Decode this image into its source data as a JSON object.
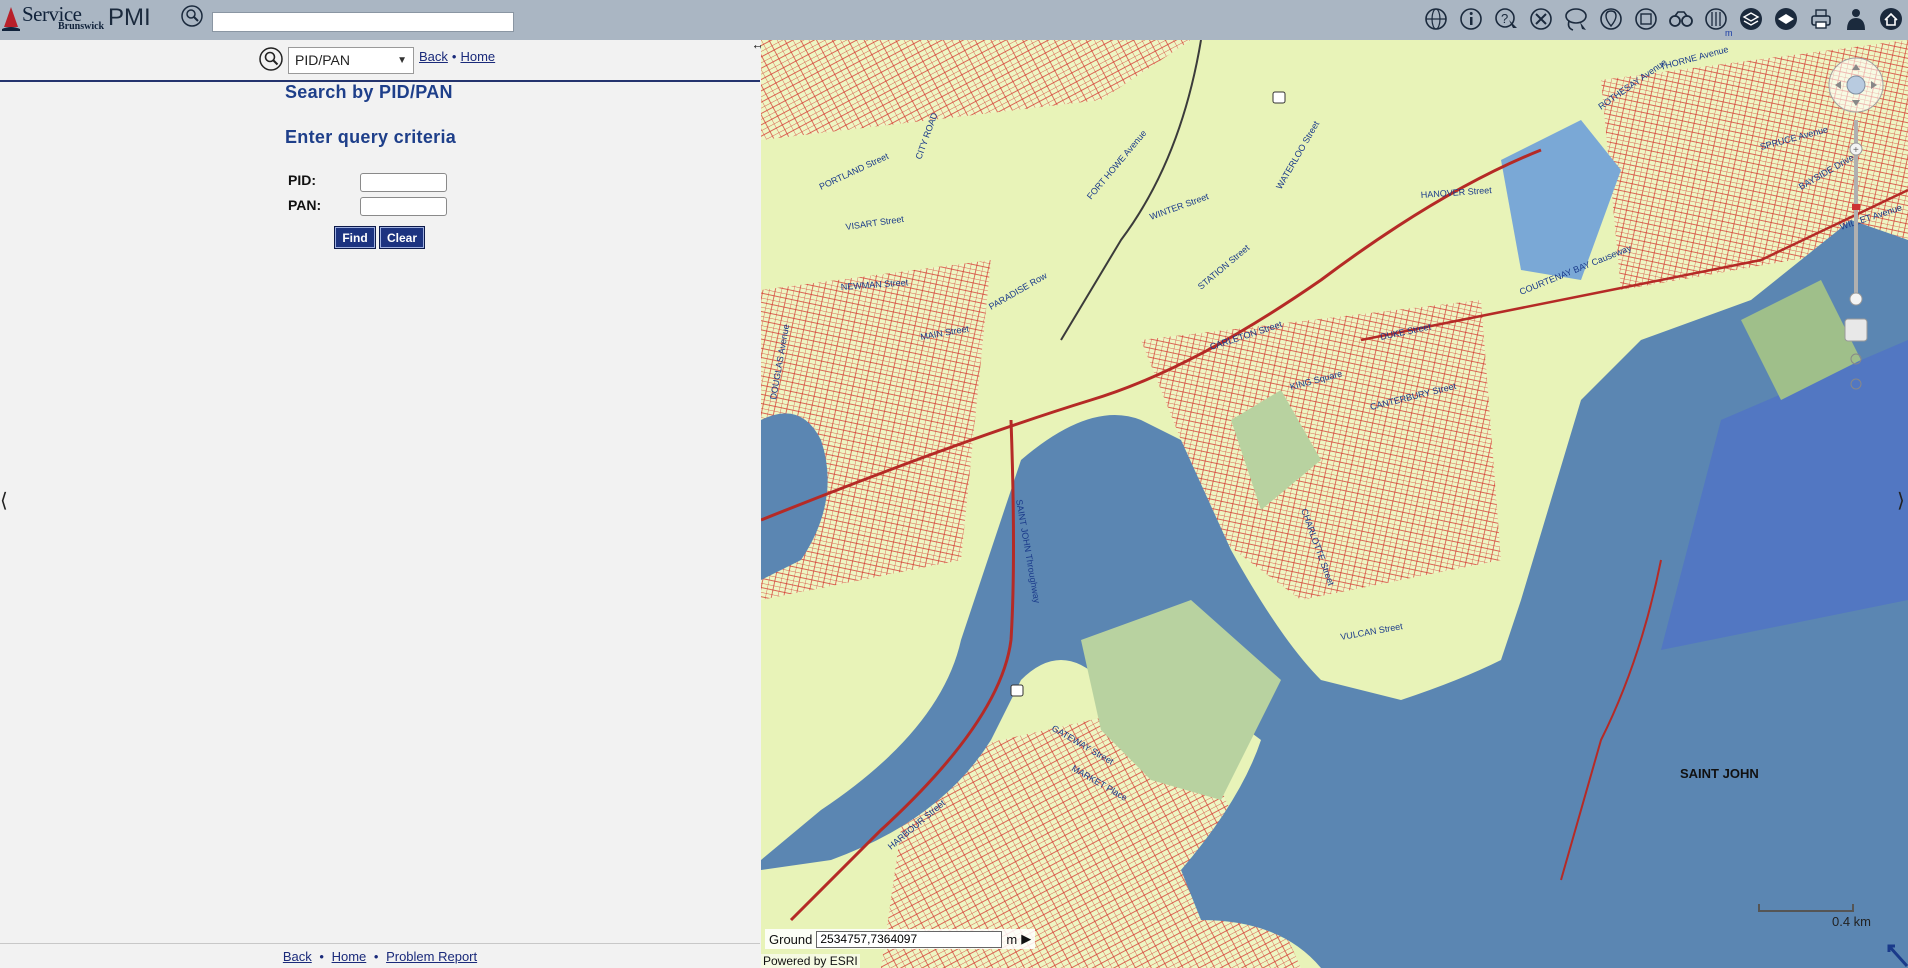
{
  "header": {
    "logo_text_primary": "Service",
    "logo_text_secondary": "Brunswick",
    "app_name": "PMI",
    "search_value": "",
    "tools": [
      {
        "icon": "globe-icon"
      },
      {
        "icon": "info-icon"
      },
      {
        "icon": "identify-icon"
      },
      {
        "icon": "clear-selection-icon"
      },
      {
        "icon": "lasso-select-icon"
      },
      {
        "icon": "location-icon"
      },
      {
        "icon": "zoom-extent-icon"
      },
      {
        "icon": "binoculars-icon"
      },
      {
        "icon": "measure-icon"
      },
      {
        "icon": "layers-icon"
      },
      {
        "icon": "basemap-icon"
      },
      {
        "icon": "print-icon"
      },
      {
        "icon": "user-icon"
      },
      {
        "icon": "home-icon"
      }
    ],
    "scale_link": "m"
  },
  "left_panel": {
    "search_type": "PID/PAN",
    "back_label": "Back",
    "home_label": "Home",
    "link_separator": "•",
    "title": "Search by PID/PAN",
    "subtitle": "Enter query criteria",
    "pid_label": "PID:",
    "pan_label": "PAN:",
    "pid_value": "",
    "pan_value": "",
    "find_label": "Find",
    "clear_label": "Clear",
    "collapse_glyph": "⟨",
    "footer": {
      "back_label": "Back",
      "home_label": "Home",
      "problem_label": "Problem Report",
      "separator": "•"
    }
  },
  "map": {
    "coord_label": "Ground",
    "coord_value": "2534757,7364097",
    "coord_unit": "m",
    "powered_by": "Powered by ESRI",
    "scale_label": "0.4 km",
    "city_label": "SAINT JOHN",
    "collapse_glyph": "⟩",
    "streets": [
      "VISART Street",
      "HANOVER Street",
      "COURTENAY BAY Causeway",
      "NEWMAN Street",
      "PARADISE Row",
      "STATION Street",
      "DUKE Street",
      "CARLETON Street",
      "KING Square",
      "CANTERBURY Street",
      "CHARLOTTE Street",
      "SAINT JOHN Throughway",
      "VULCAN Street",
      "GATEWAY Street",
      "MARKET Place",
      "HARBOUR Street",
      "CITY ROAD",
      "WATERLOO Street",
      "WINTER Street",
      "THORNE Avenue",
      "BAYSIDE Drive",
      "SPRUCE Avenue",
      "WILLET Avenue",
      "PORTLAND Street",
      "ROTHESAY Avenue",
      "FORT HOWE Avenue",
      "MAIN Street",
      "DOUGLAS Avenue"
    ],
    "colors": {
      "land": "#e8f3b8",
      "water": "#5b86b2",
      "park": "#b8d2a0",
      "parcel": "#d4372f",
      "road": "#4a4a4a"
    }
  }
}
